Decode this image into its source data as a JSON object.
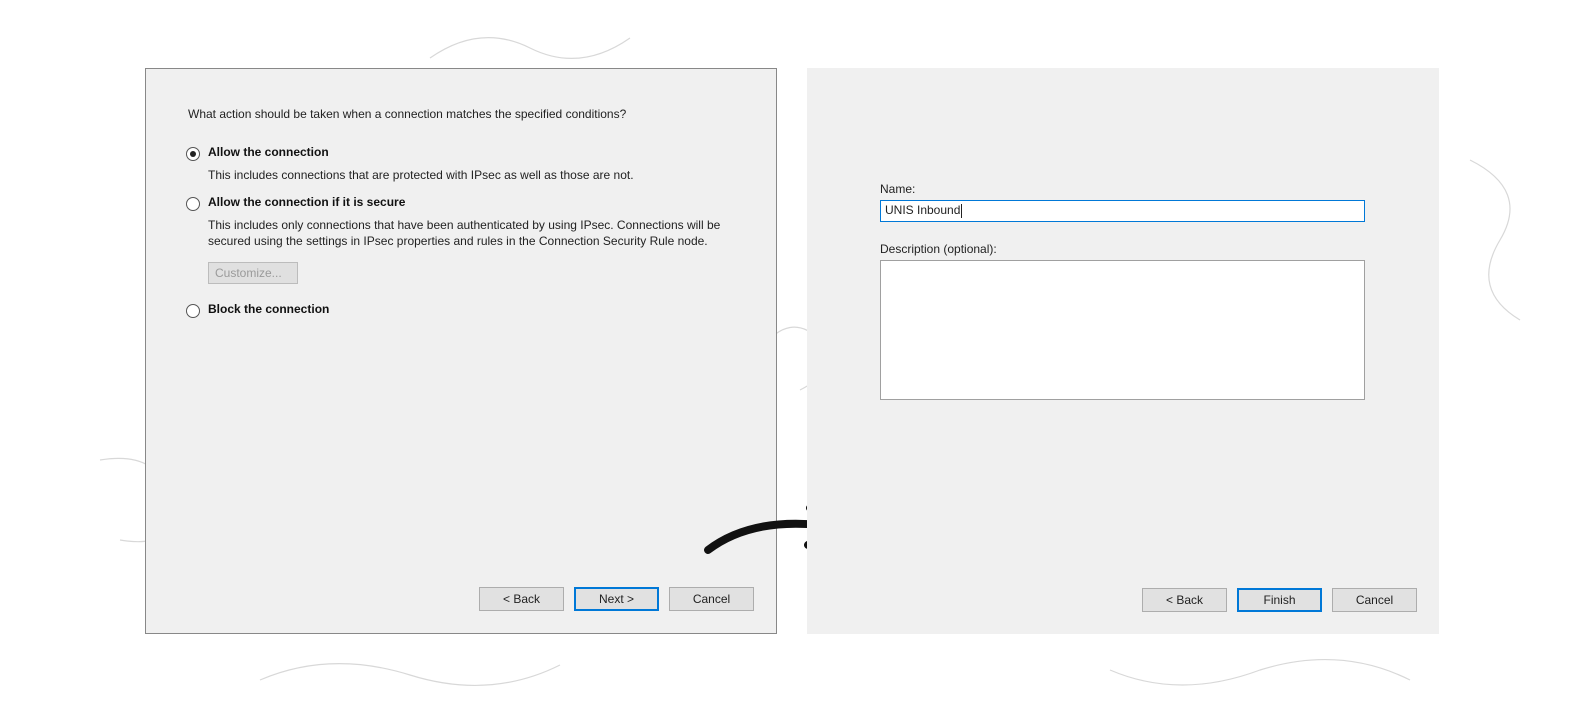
{
  "left": {
    "question": "What action should be taken when a connection matches the specified conditions?",
    "options": [
      {
        "label": "Allow the connection",
        "desc": "This includes connections that are protected with IPsec as well as those are not.",
        "checked": true
      },
      {
        "label": "Allow the connection if it is secure",
        "desc": "This includes only connections that have been authenticated by using IPsec.  Connections will be secured using the settings in IPsec properties and rules in the Connection Security Rule node.",
        "checked": false,
        "customize": "Customize..."
      },
      {
        "label": "Block the connection",
        "checked": false
      }
    ],
    "buttons": {
      "back": "< Back",
      "next": "Next >",
      "cancel": "Cancel"
    }
  },
  "right": {
    "name_label": "Name:",
    "name_value": "UNIS Inbound",
    "desc_label": "Description (optional):",
    "desc_value": "",
    "buttons": {
      "back": "< Back",
      "finish": "Finish",
      "cancel": "Cancel"
    }
  }
}
